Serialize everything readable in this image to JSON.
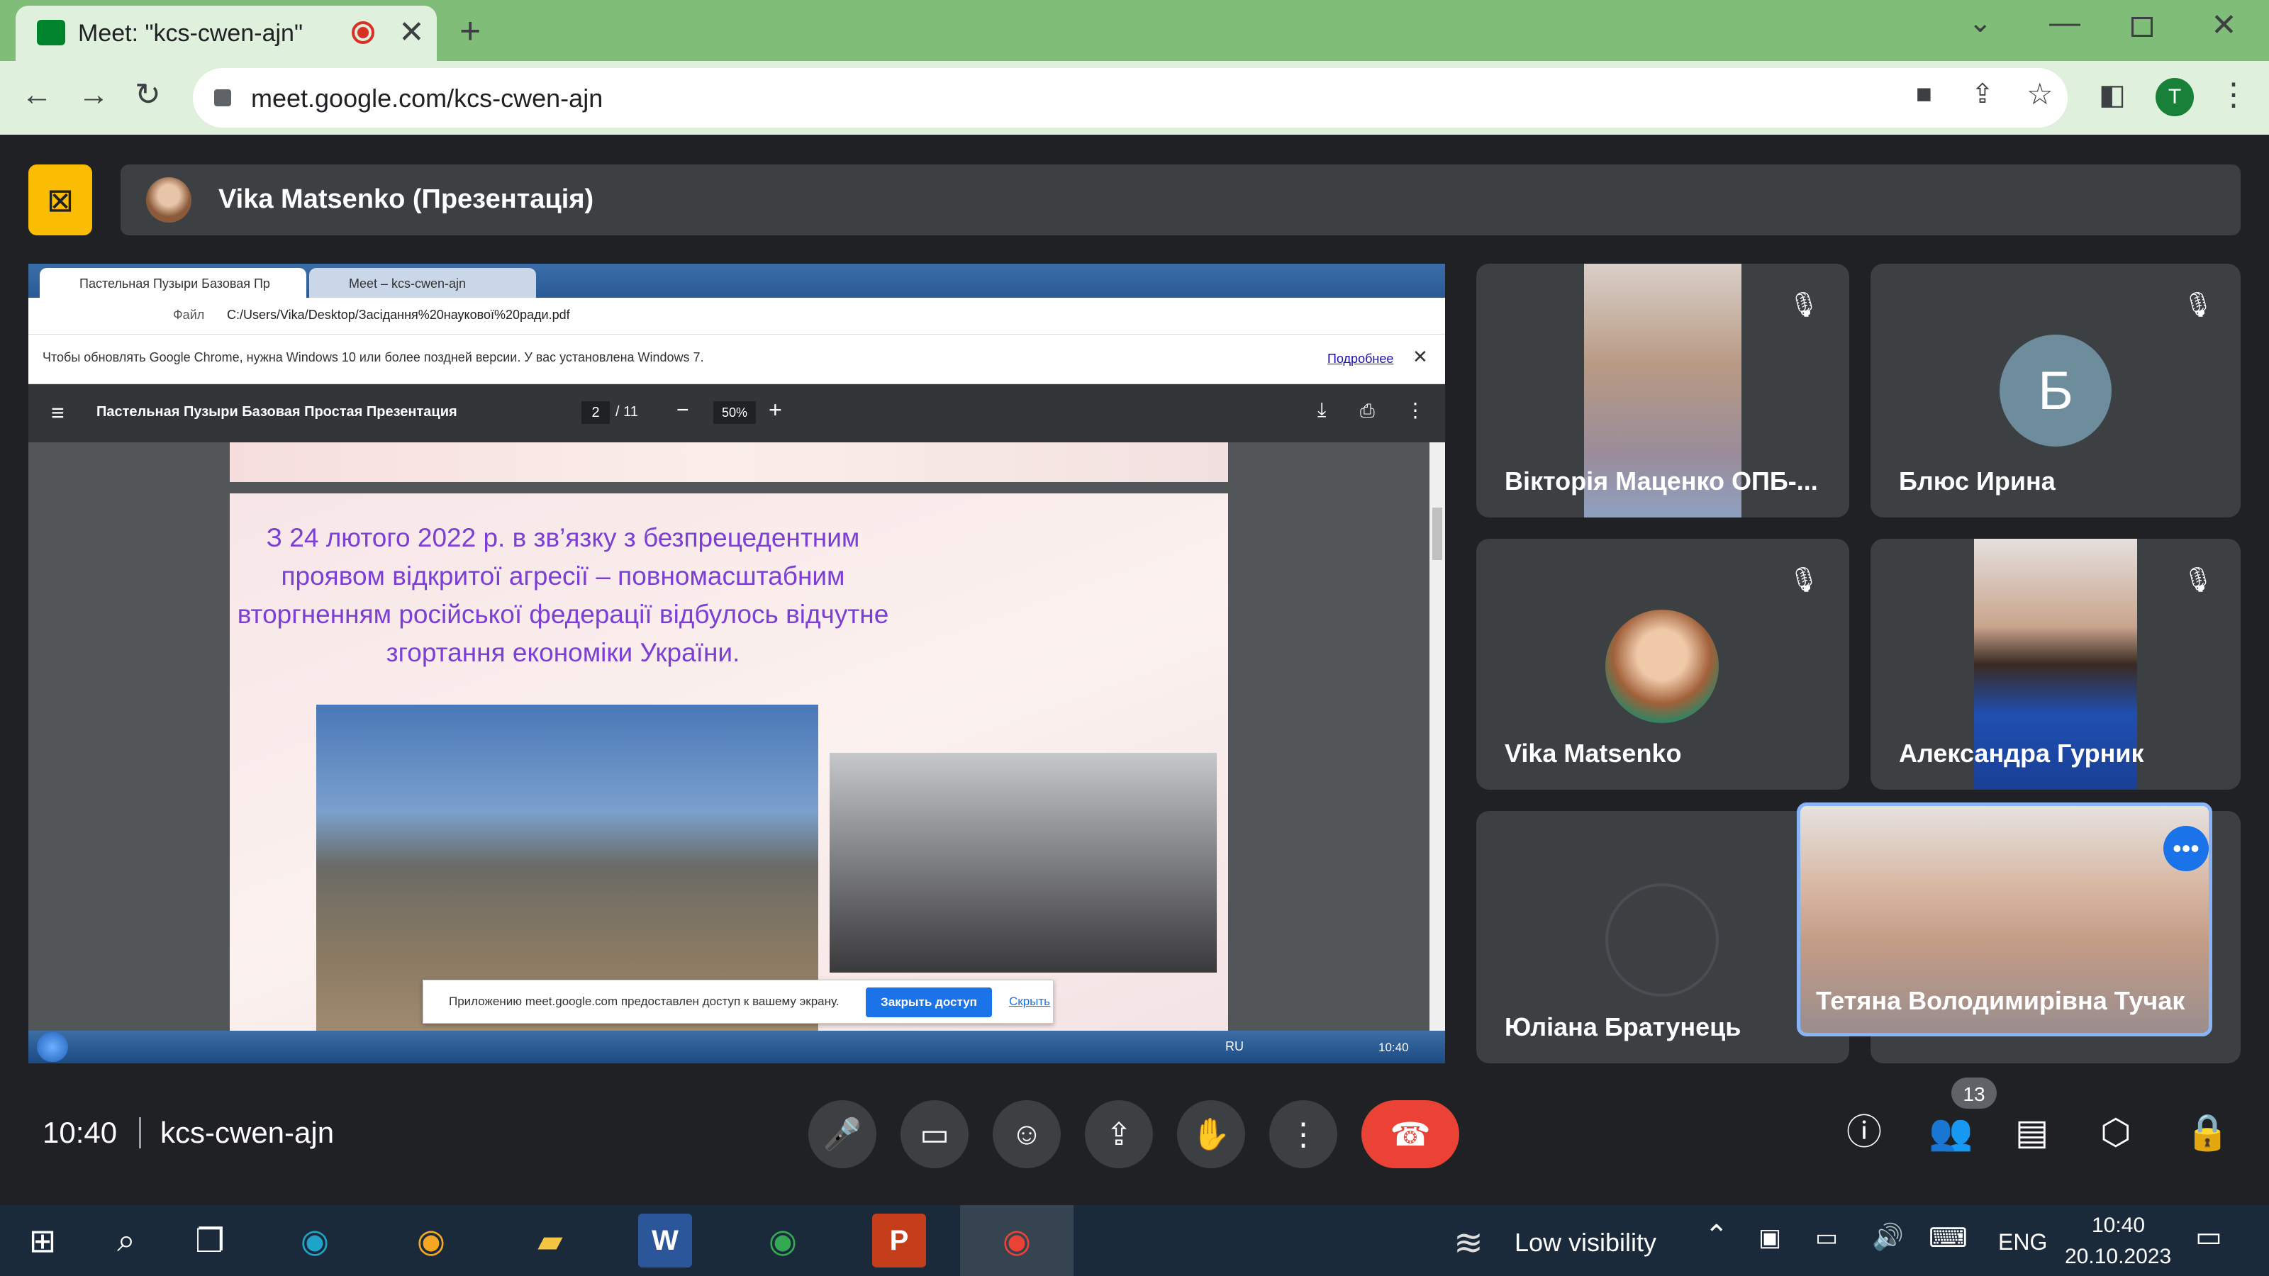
{
  "browser": {
    "tab_title": "Meet: \"kcs-cwen-ajn\"",
    "url": "meet.google.com/kcs-cwen-ajn",
    "profile_initial": "T"
  },
  "meet": {
    "presenter_label": "Vika Matsenko (Презентація)",
    "time": "10:40",
    "meeting_code": "kcs-cwen-ajn",
    "participants_count": "13"
  },
  "shared": {
    "tab1": "Пастельная Пузыри Базовая Пр",
    "tab2": "Meet – kcs-cwen-ajn",
    "file_label": "Файл",
    "path": "C:/Users/Vika/Desktop/Засідання%20наукової%20ради.pdf",
    "warning": "Чтобы обновлять Google Chrome, нужна Windows 10 или более поздней версии. У вас установлена Windows 7.",
    "warning_link": "Подробнее",
    "pdf_title": "Пастельная Пузыри Базовая Простая Презентация",
    "page_current": "2",
    "page_total": "/ 11",
    "zoom": "50%",
    "slide_text": "З 24 лютого 2022 р. в зв’язку з безпрецедентним проявом відкритої агресії – повномасштабним вторгненням російської федерації відбулось відчутне згортання економіки України.",
    "sharing_notice": "Приложению meet.google.com предоставлен доступ к вашему экрану.",
    "stop_sharing": "Закрыть доступ",
    "hide": "Скрыть",
    "win7_lang": "RU",
    "win7_time": "10:40"
  },
  "participants": [
    {
      "name": "Вікторія Маценко ОПБ-..."
    },
    {
      "name": "Блюс Ирина",
      "initial": "Б"
    },
    {
      "name": "Vika Matsenko"
    },
    {
      "name": "Александра Гурник"
    },
    {
      "name": "Юліана Братунець"
    },
    {
      "name": "Тетяна Володимирівна Тучак"
    }
  ],
  "taskbar": {
    "weather": "Low visibility",
    "lang": "ENG",
    "time": "10:40",
    "date": "20.10.2023"
  },
  "colors": {
    "tabbar": "#7fbd78",
    "meet_bg": "#202124",
    "end_call": "#ea4335",
    "accent": "#1a73e8"
  }
}
